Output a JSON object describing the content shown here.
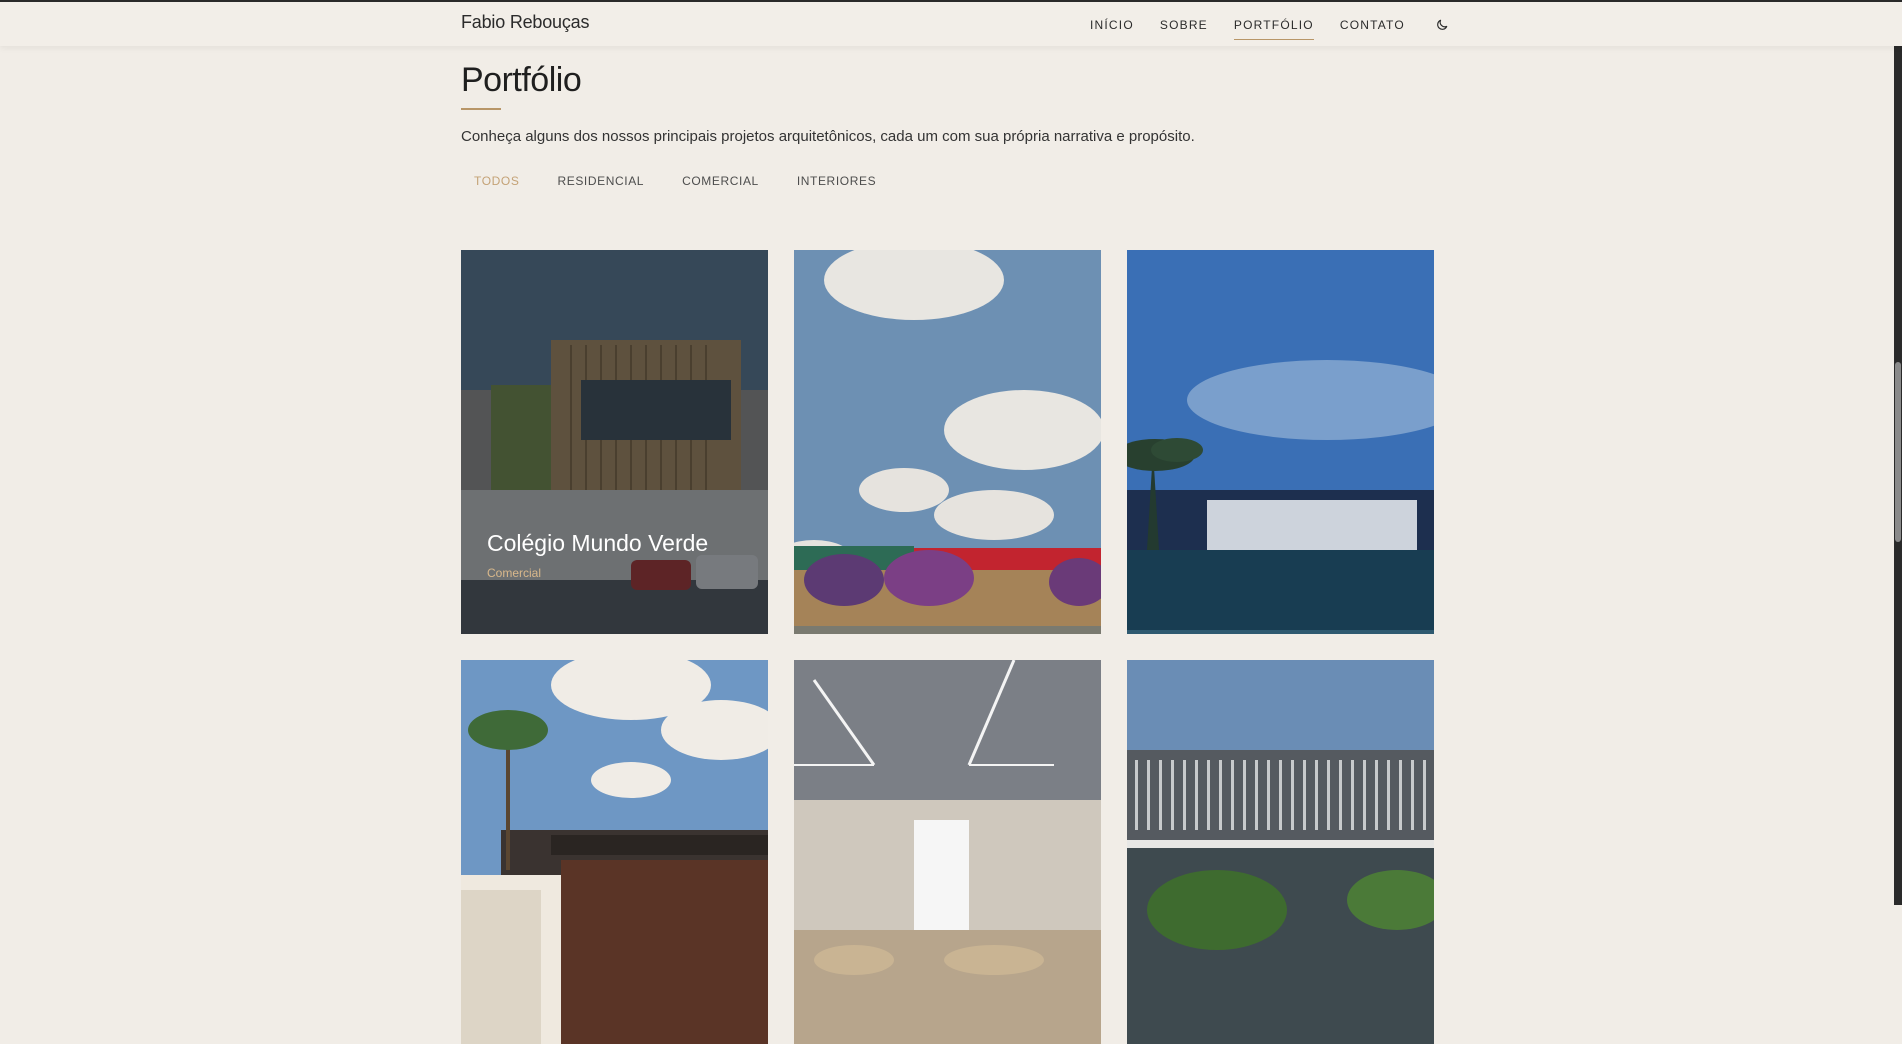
{
  "header": {
    "brand": "Fabio Rebouças",
    "nav": [
      {
        "label": "INÍCIO"
      },
      {
        "label": "SOBRE"
      },
      {
        "label": "PORTFÓLIO",
        "active": true
      },
      {
        "label": "CONTATO"
      }
    ],
    "theme_toggle_icon": "moon-icon"
  },
  "portfolio": {
    "title": "Portfólio",
    "intro": "Conheça alguns dos nossos principais projetos arquitetônicos, cada um com sua própria narrativa e propósito.",
    "filters": [
      {
        "label": "TODOS",
        "active": true
      },
      {
        "label": "RESIDENCIAL"
      },
      {
        "label": "COMERCIAL"
      },
      {
        "label": "INTERIORES"
      }
    ],
    "cards": [
      {
        "title": "Colégio Mundo Verde",
        "category": "Comercial",
        "hovered": true
      }
    ]
  },
  "colors": {
    "background": "#f1ede7",
    "accent": "#b89668",
    "text": "#2b2b2b"
  }
}
